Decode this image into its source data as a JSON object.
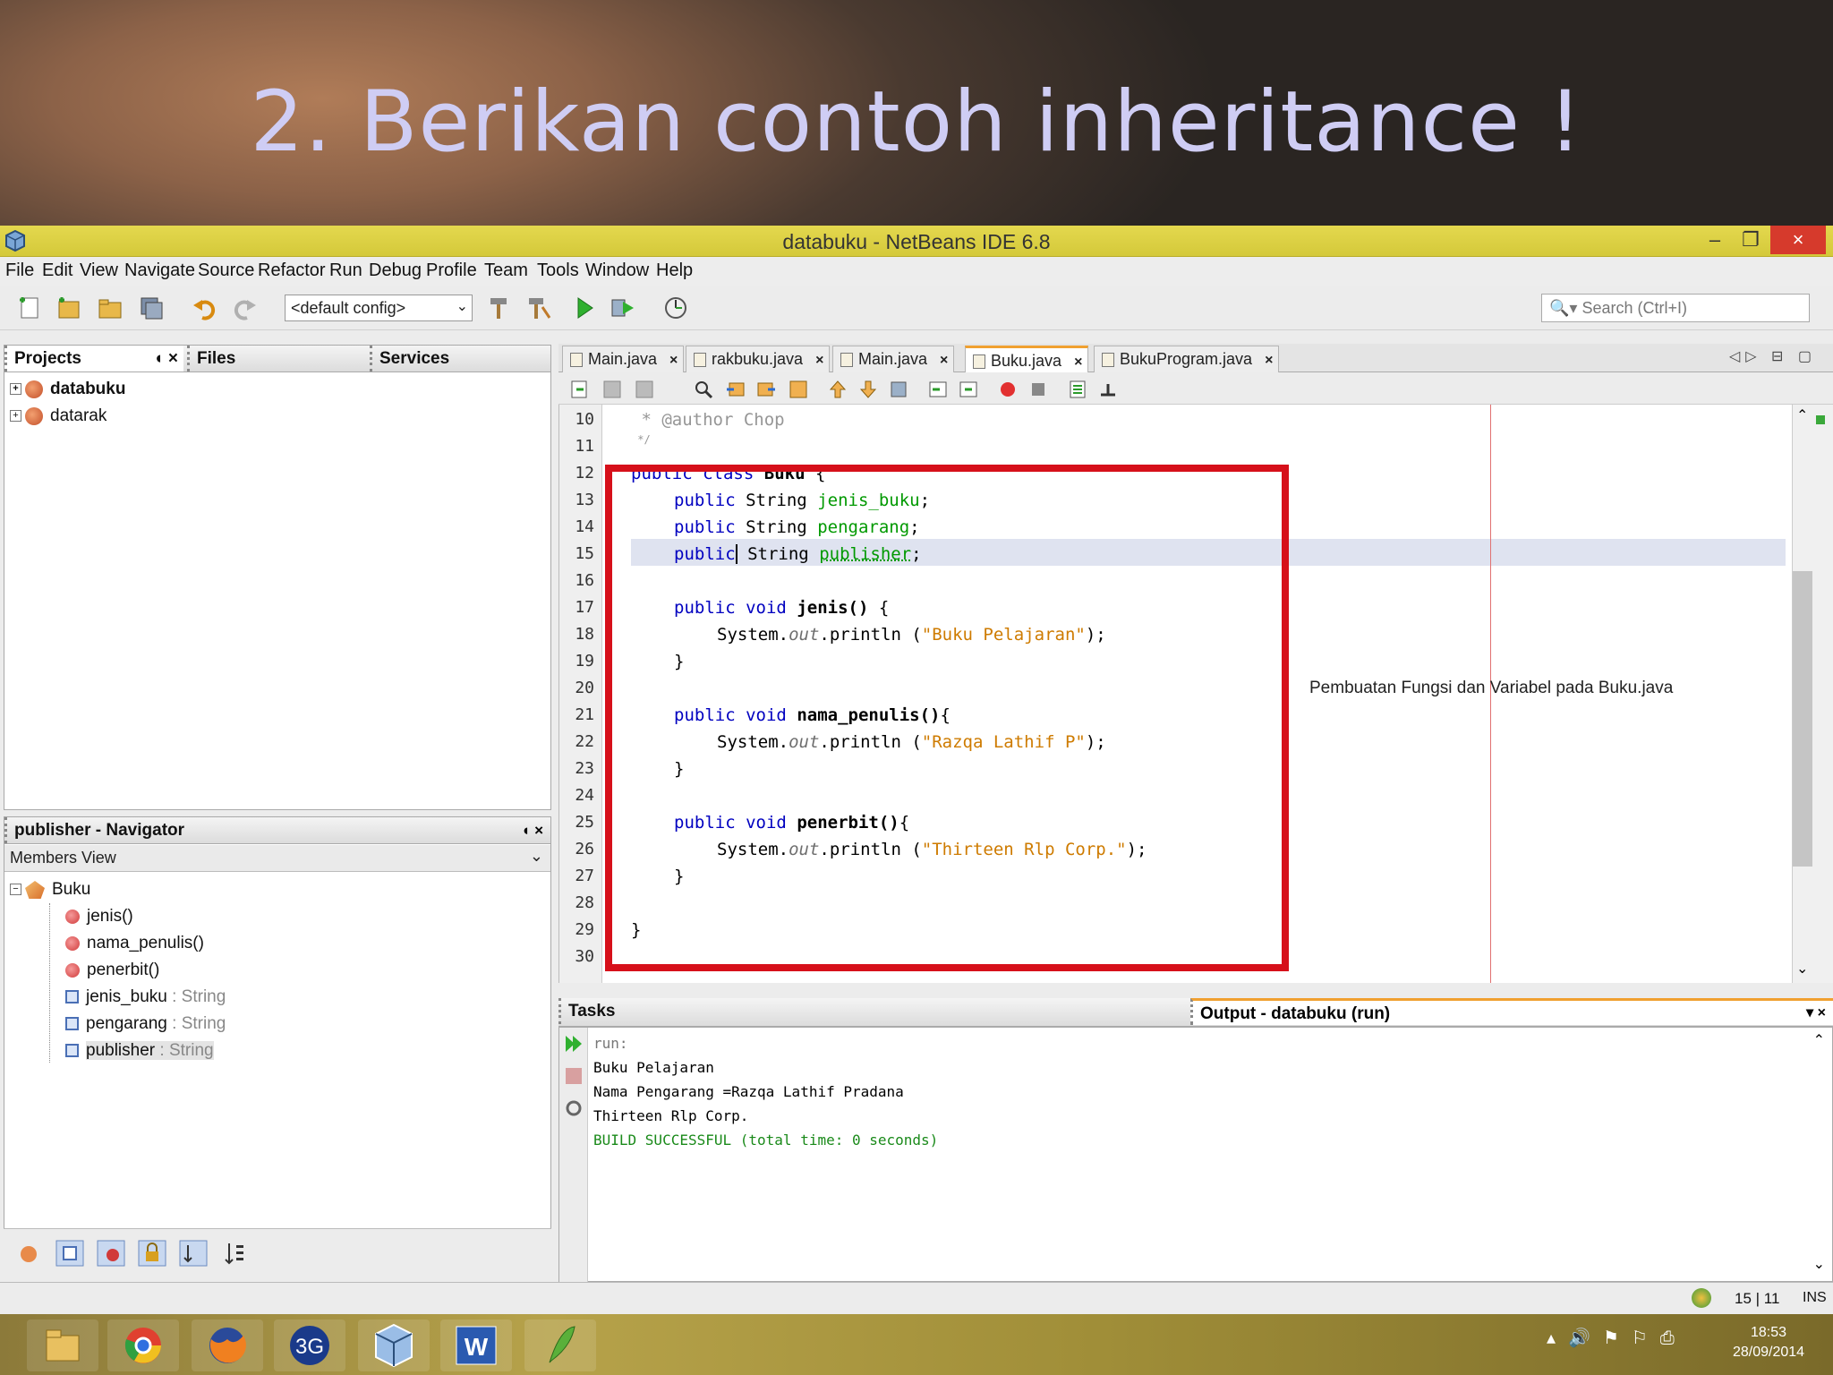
{
  "slide": {
    "title": "2. Berikan contoh inheritance !"
  },
  "window": {
    "title": "databuku - NetBeans IDE 6.8",
    "minimize": "–",
    "restore": "❐",
    "close": "×"
  },
  "menu": [
    "File",
    "Edit",
    "View",
    "Navigate",
    "Source",
    "Refactor",
    "Run",
    "Debug",
    "Profile",
    "Team",
    "Tools",
    "Window",
    "Help"
  ],
  "toolbar": {
    "config": "<default config>",
    "search_placeholder": "Search (Ctrl+I)"
  },
  "projects_panel": {
    "tabs": [
      "Projects",
      "Files",
      "Services"
    ],
    "items": [
      "databuku",
      "datarak"
    ]
  },
  "navigator": {
    "title": "publisher - Navigator",
    "view": "Members View",
    "root": "Buku",
    "methods": [
      "jenis()",
      "nama_penulis()",
      "penerbit()"
    ],
    "fields": [
      {
        "name": "jenis_buku",
        "type": " : String"
      },
      {
        "name": "pengarang",
        "type": " : String"
      },
      {
        "name": "publisher",
        "type": " : String"
      }
    ]
  },
  "editor_tabs": [
    "Main.java",
    "rakbuku.java",
    "Main.java",
    "Buku.java",
    "BukuProgram.java"
  ],
  "editor": {
    "line_numbers": [
      "10",
      "11",
      "12",
      "13",
      "14",
      "15",
      "16",
      "17",
      "18",
      "19",
      "20",
      "21",
      "22",
      "23",
      "24",
      "25",
      "26",
      "27",
      "28",
      "29",
      "30"
    ],
    "comment_author": " * @author Chop",
    "comment_end": " */",
    "public": "public",
    "class": "class",
    "void": "void",
    "String": "String",
    "class_name": "Buku",
    "open_brace": "{",
    "close_brace": "}",
    "fields": [
      "jenis_buku",
      "pengarang",
      "publisher"
    ],
    "semicolon": ";",
    "methods": [
      {
        "sig": "jenis()",
        "brace": " {",
        "str": "\"Buku Pelajaran\""
      },
      {
        "sig": "nama_penulis()",
        "brace": "{",
        "str": "\"Razqa Lathif P\""
      },
      {
        "sig": "penerbit()",
        "brace": "{",
        "str": "\"Thirteen Rlp Corp.\""
      }
    ],
    "system": "System.",
    "out": "out",
    "println": ".println (",
    "close_call": ");",
    "annotation": "Pembuatan Fungsi dan Variabel pada Buku.java"
  },
  "bottom": {
    "tasks_tab": "Tasks",
    "output_tab": "Output - databuku (run)",
    "lines": [
      "run:",
      "Buku Pelajaran",
      "Nama Pengarang =Razqa Lathif Pradana",
      "Thirteen Rlp Corp.",
      "BUILD SUCCESSFUL (total time: 0 seconds)"
    ]
  },
  "status": {
    "position": "15 | 11",
    "mode": "INS"
  },
  "taskbar": {
    "time": "18:53",
    "date": "28/09/2014"
  }
}
